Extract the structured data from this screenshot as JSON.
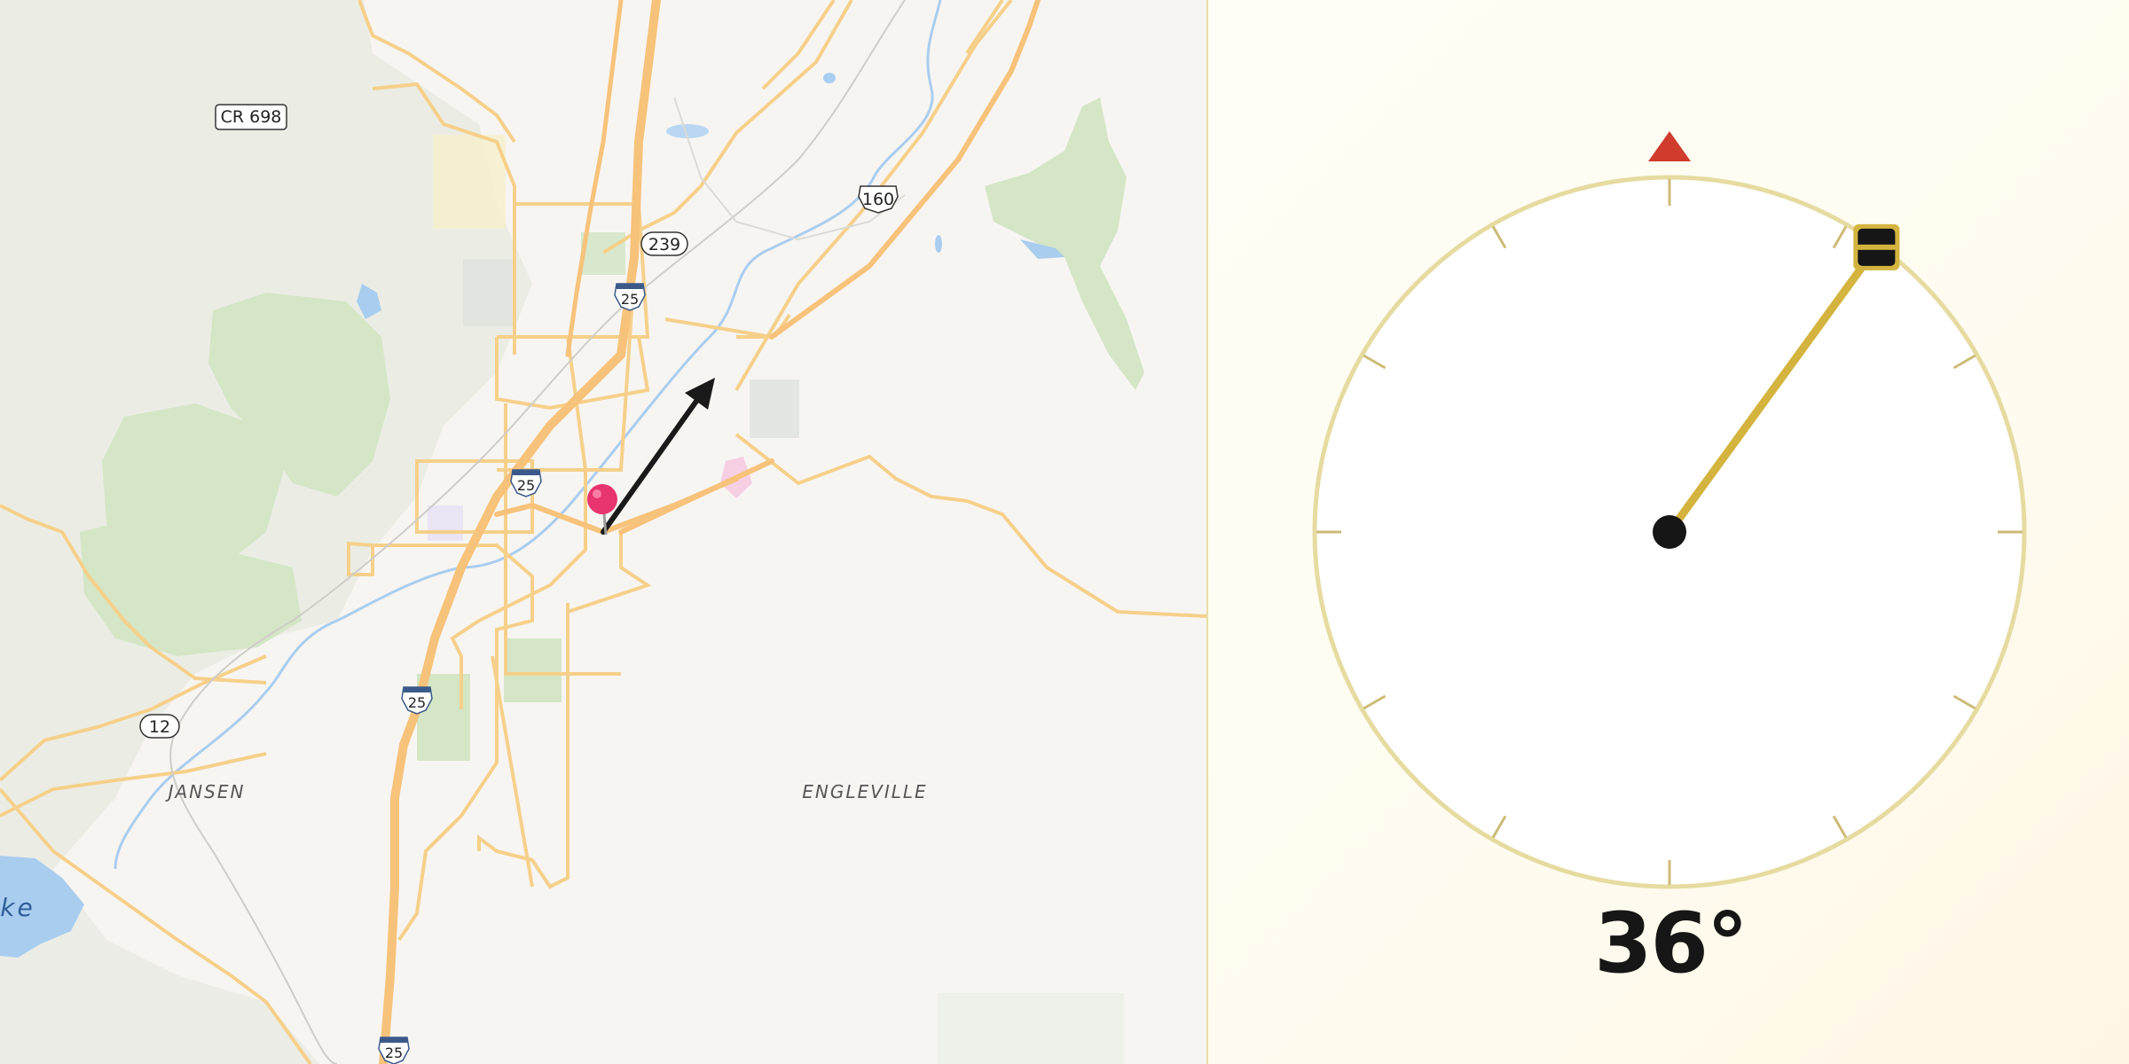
{
  "map": {
    "places": {
      "jansen": "JANSEN",
      "engleville": "ENGLEVILLE",
      "lake_fragment": "ke"
    },
    "route_shields": {
      "cr698": "CR 698",
      "us160": "160",
      "co239": "239",
      "i25_north": "25",
      "i25_center": "25",
      "i25_south": "25",
      "i25_bottom": "25",
      "co12": "12"
    },
    "colors": {
      "land": "#f7f5f2",
      "terrain": "#e9ece3",
      "park": "#d4e6c6",
      "road": "#f6d08a",
      "highway": "#f7c27a",
      "water": "#a9cdef",
      "pin": "#e8346f",
      "arrow": "#1a1a1a"
    }
  },
  "compass": {
    "heading_deg": 36,
    "heading_label": "36°",
    "colors": {
      "ring": "#e6dba0",
      "needle": "#d4b43e",
      "north_marker": "#cf3b2c",
      "tick": "#cdbb76",
      "hub": "#161616"
    },
    "icons": {
      "north": "north-triangle-icon",
      "handle": "drag-handle-icon"
    }
  }
}
